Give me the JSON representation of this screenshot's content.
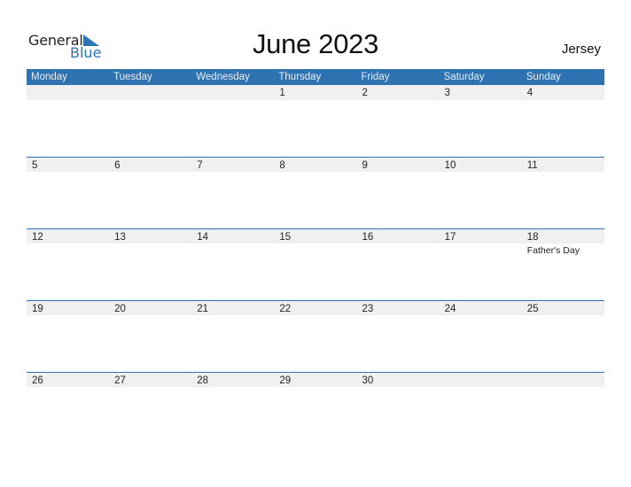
{
  "logo": {
    "text_general": "General",
    "text_blue": "Blue",
    "icon": "triangle-flag-icon",
    "brand_color": "#2e75b6"
  },
  "title": "June 2023",
  "country": "Jersey",
  "header_color": "#2e72b2",
  "days_of_week": [
    "Monday",
    "Tuesday",
    "Wednesday",
    "Thursday",
    "Friday",
    "Saturday",
    "Sunday"
  ],
  "weeks": [
    {
      "days": [
        {
          "date": ""
        },
        {
          "date": ""
        },
        {
          "date": ""
        },
        {
          "date": "1"
        },
        {
          "date": "2"
        },
        {
          "date": "3"
        },
        {
          "date": "4"
        }
      ]
    },
    {
      "days": [
        {
          "date": "5"
        },
        {
          "date": "6"
        },
        {
          "date": "7"
        },
        {
          "date": "8"
        },
        {
          "date": "9"
        },
        {
          "date": "10"
        },
        {
          "date": "11"
        }
      ]
    },
    {
      "days": [
        {
          "date": "12"
        },
        {
          "date": "13"
        },
        {
          "date": "14"
        },
        {
          "date": "15"
        },
        {
          "date": "16"
        },
        {
          "date": "17"
        },
        {
          "date": "18",
          "holiday": "Father's Day"
        }
      ]
    },
    {
      "days": [
        {
          "date": "19"
        },
        {
          "date": "20"
        },
        {
          "date": "21"
        },
        {
          "date": "22"
        },
        {
          "date": "23"
        },
        {
          "date": "24"
        },
        {
          "date": "25"
        }
      ]
    },
    {
      "days": [
        {
          "date": "26"
        },
        {
          "date": "27"
        },
        {
          "date": "28"
        },
        {
          "date": "29"
        },
        {
          "date": "30"
        },
        {
          "date": ""
        },
        {
          "date": ""
        }
      ]
    }
  ]
}
